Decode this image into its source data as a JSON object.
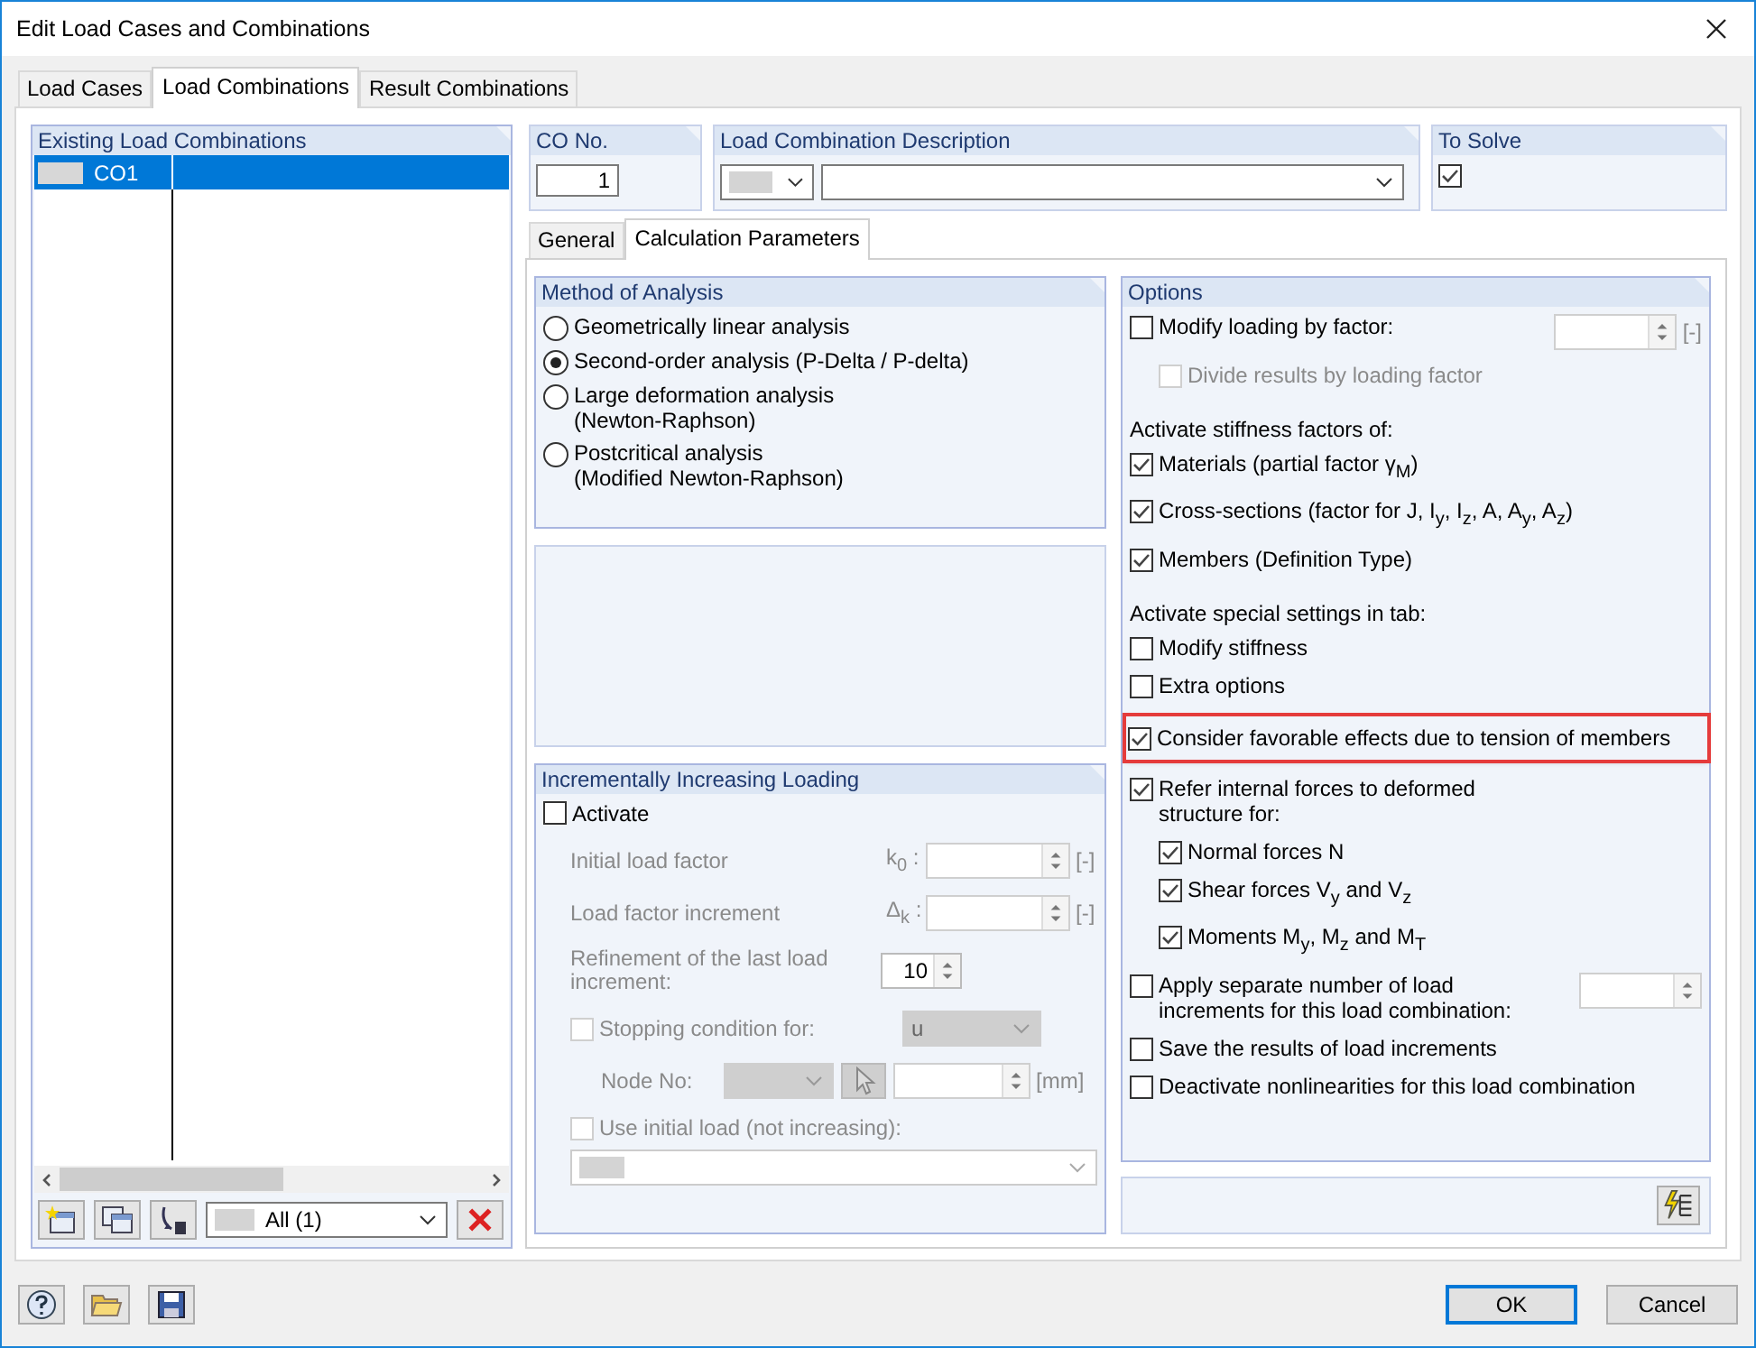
{
  "window": {
    "title": "Edit Load Cases and Combinations"
  },
  "tabs": [
    {
      "label": "Load Cases",
      "selected": false
    },
    {
      "label": "Load Combinations",
      "selected": true
    },
    {
      "label": "Result Combinations",
      "selected": false
    }
  ],
  "combinations": {
    "header": "Existing Load Combinations",
    "rows": [
      {
        "name": "CO1",
        "selected": true
      }
    ],
    "filter": "All (1)"
  },
  "co_no": {
    "label": "CO No.",
    "value": "1"
  },
  "description": {
    "label": "Load Combination Description"
  },
  "to_solve": {
    "label": "To Solve",
    "checked": true
  },
  "subtabs": [
    {
      "label": "General",
      "selected": false
    },
    {
      "label": "Calculation Parameters",
      "selected": true
    }
  ],
  "method": {
    "title": "Method of Analysis",
    "options": [
      {
        "label": "Geometrically linear analysis",
        "selected": false
      },
      {
        "label": "Second-order analysis (P-Delta / P-delta)",
        "selected": true
      },
      {
        "label": "Large deformation analysis\n(Newton-Raphson)",
        "selected": false
      },
      {
        "label": "Postcritical analysis\n(Modified Newton-Raphson)",
        "selected": false
      }
    ]
  },
  "incremental": {
    "title": "Incrementally Increasing Loading",
    "activate": {
      "label": "Activate",
      "checked": false
    },
    "fields": [
      {
        "label": "Initial load factor",
        "symbol": "k$_{0}$ :",
        "unit": "[-]"
      },
      {
        "label": "Load factor increment",
        "symbol": "Δ$_{k}$ :",
        "unit": "[-]"
      }
    ],
    "refinement": {
      "label": "Refinement of the last load\nincrement:",
      "value": "10"
    },
    "stopping": {
      "label": "Stopping condition for:",
      "checked": false,
      "value": "u"
    },
    "node": {
      "label": "Node No:",
      "unit": "[mm]"
    },
    "initial_load": {
      "label": "Use initial load (not increasing):",
      "checked": false
    }
  },
  "options": {
    "title": "Options",
    "items": [
      {
        "kind": "check",
        "label": "Modify loading by factor:",
        "checked": false,
        "spinner": true,
        "unit": "[-]",
        "children": [
          {
            "kind": "check",
            "label": "Divide results by loading factor",
            "checked": false,
            "disabled": true
          }
        ]
      },
      {
        "kind": "heading",
        "label": "Activate stiffness factors of:"
      },
      {
        "kind": "check",
        "label": "Materials (partial factor γ$_{M}$)",
        "checked": true
      },
      {
        "kind": "check",
        "label": "Cross-sections (factor for J, I$_{y}$, I$_{z}$, A, A$_{y}$, A$_{z}$)",
        "checked": true
      },
      {
        "kind": "check",
        "label": "Members (Definition Type)",
        "checked": true
      },
      {
        "kind": "heading",
        "label": "Activate special settings in tab:"
      },
      {
        "kind": "check",
        "label": "Modify stiffness",
        "checked": false
      },
      {
        "kind": "check",
        "label": "Extra options",
        "checked": false
      },
      {
        "kind": "check",
        "label": "Consider favorable effects due to tension of members",
        "checked": true,
        "highlighted": true
      },
      {
        "kind": "check",
        "label": "Refer internal forces to deformed\nstructure for:",
        "checked": true,
        "children": [
          {
            "kind": "check",
            "label": "Normal forces N",
            "checked": true
          },
          {
            "kind": "check",
            "label": "Shear forces V$_{y}$ and V$_{z}$",
            "checked": true
          },
          {
            "kind": "check",
            "label": "Moments M$_{y}$, M$_{z}$ and M$_{T}$",
            "checked": true
          }
        ]
      },
      {
        "kind": "check",
        "label": "Apply separate number of load\nincrements for this load combination:",
        "checked": false,
        "spinner": true
      },
      {
        "kind": "check",
        "label": "Save the results of load increments",
        "checked": false
      },
      {
        "kind": "check",
        "label": "Deactivate nonlinearities for this load combination",
        "checked": false
      }
    ]
  },
  "buttons": [
    {
      "label": "OK",
      "default": true
    },
    {
      "label": "Cancel",
      "default": false
    }
  ]
}
